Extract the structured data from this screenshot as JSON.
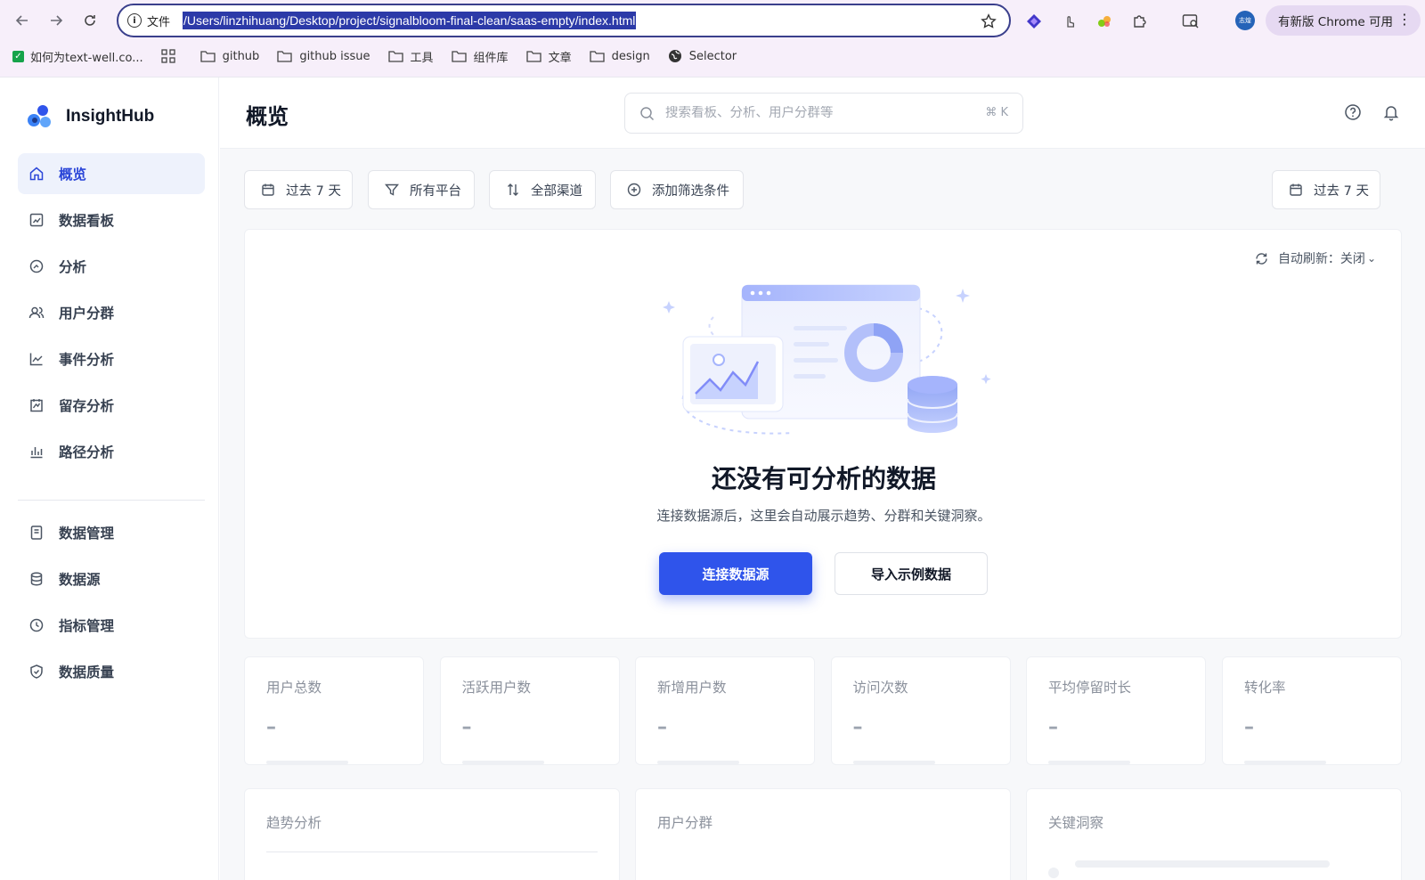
{
  "browser": {
    "page_info_label": "文件",
    "url": "/Users/linzhihuang/Desktop/project/signalbloom-final-clean/saas-empty/index.html",
    "profile_initials": "志煌",
    "update_label": "有新版 Chrome 可用",
    "bookmarks": [
      "如何为text-well.co...",
      "github",
      "github issue",
      "工具",
      "组件库",
      "文章",
      "design",
      "Selector"
    ]
  },
  "app": {
    "brand": "InsightHub",
    "accent_color": "#2f54eb",
    "nav_primary": [
      {
        "label": "概览",
        "icon": "home-icon",
        "active": true
      },
      {
        "label": "数据看板",
        "icon": "dashboard-icon",
        "active": false
      },
      {
        "label": "分析",
        "icon": "analysis-icon",
        "active": false
      },
      {
        "label": "用户分群",
        "icon": "users-icon",
        "active": false
      },
      {
        "label": "事件分析",
        "icon": "line-chart-icon",
        "active": false
      },
      {
        "label": "留存分析",
        "icon": "retention-icon",
        "active": false
      },
      {
        "label": "路径分析",
        "icon": "path-icon",
        "active": false
      }
    ],
    "nav_secondary": [
      {
        "label": "数据管理",
        "icon": "document-icon"
      },
      {
        "label": "数据源",
        "icon": "database-icon"
      },
      {
        "label": "指标管理",
        "icon": "clock-icon"
      },
      {
        "label": "数据质量",
        "icon": "shield-icon"
      }
    ]
  },
  "header": {
    "title": "概览",
    "search_placeholder": "搜索看板、分析、用户分群等",
    "search_shortcut": "⌘ K"
  },
  "filters": {
    "time_range": "过去 7 天",
    "platform": "所有平台",
    "channel": "全部渠道",
    "add_filter": "添加筛选条件",
    "date_picker": "过去 7 天"
  },
  "empty_state": {
    "auto_refresh": "自动刷新：关闭",
    "title": "还没有可分析的数据",
    "description": "连接数据源后，这里会自动展示趋势、分群和关键洞察。",
    "primary_action": "连接数据源",
    "secondary_action": "导入示例数据"
  },
  "metrics": [
    {
      "label": "用户总数",
      "value": "–"
    },
    {
      "label": "活跃用户数",
      "value": "–"
    },
    {
      "label": "新增用户数",
      "value": "–"
    },
    {
      "label": "访问次数",
      "value": "–"
    },
    {
      "label": "平均停留时长",
      "value": "–"
    },
    {
      "label": "转化率",
      "value": "–"
    }
  ],
  "panels": [
    {
      "label": "趋势分析"
    },
    {
      "label": "用户分群"
    },
    {
      "label": "关键洞察"
    }
  ]
}
